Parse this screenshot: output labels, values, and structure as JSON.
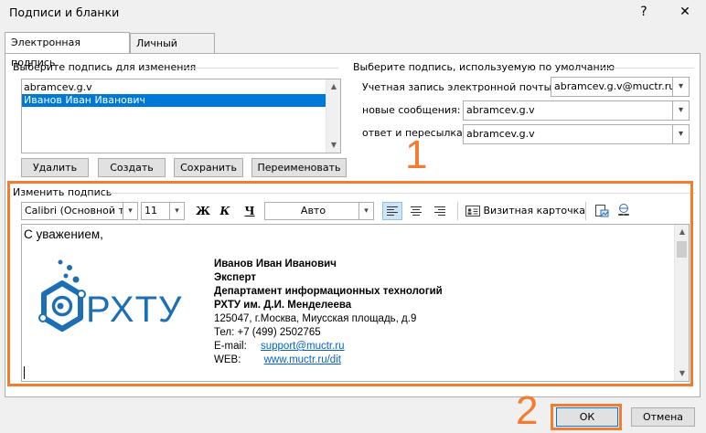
{
  "window": {
    "title": "Подписи и бланки",
    "help": "?",
    "close": "✕"
  },
  "tabs": [
    {
      "label": "Электронная подпись"
    },
    {
      "label": "Личный бланк"
    }
  ],
  "select_section": {
    "label": "Выберите подпись для изменения",
    "items": [
      "abramcev.g.v",
      "Иванов Иван Иванович"
    ],
    "selected_index": 1
  },
  "buttons": {
    "delete": "Удалить",
    "create": "Создать",
    "save": "Сохранить",
    "rename": "Переименовать"
  },
  "default_section": {
    "label": "Выберите подпись, используемую по умолчанию",
    "account_label": "Учетная запись электронной почты:",
    "account_value": "abramcev.g.v@muctr.ru",
    "new_messages_label": "новые сообщения:",
    "new_messages_value": "abramcev.g.v",
    "replies_label": "ответ и пересылка:",
    "replies_value": "abramcev.g.v"
  },
  "edit_section": {
    "label": "Изменить подпись",
    "font": "Calibri (Основной те",
    "size": "11",
    "bold": "Ж",
    "italic": "К",
    "underline": "Ч",
    "color": "Авто",
    "business_card": "Визитная карточка"
  },
  "signature": {
    "greeting": "С уважением,",
    "logo_text": "РХТУ",
    "name": "Иванов Иван Иванович",
    "position": "Эксперт",
    "department": "Департамент информационных технологий",
    "org": "РХТУ им. Д.И. Менделеева",
    "address": "125047, г.Москва, Миусская площадь, д.9",
    "phone": "Тел: +7 (499) 2502765",
    "email_label": "E-mail:",
    "email": "support@muctr.ru",
    "web_label": "WEB:",
    "web": "www.muctr.ru/dit"
  },
  "footer": {
    "ok": "ОК",
    "cancel": "Отмена"
  },
  "annotations": {
    "step1": "1",
    "step2": "2"
  },
  "colors": {
    "highlight": "#f47c30",
    "selection": "#0078d7",
    "logo_blue": "#1c6fb4",
    "link": "#0563c1"
  }
}
